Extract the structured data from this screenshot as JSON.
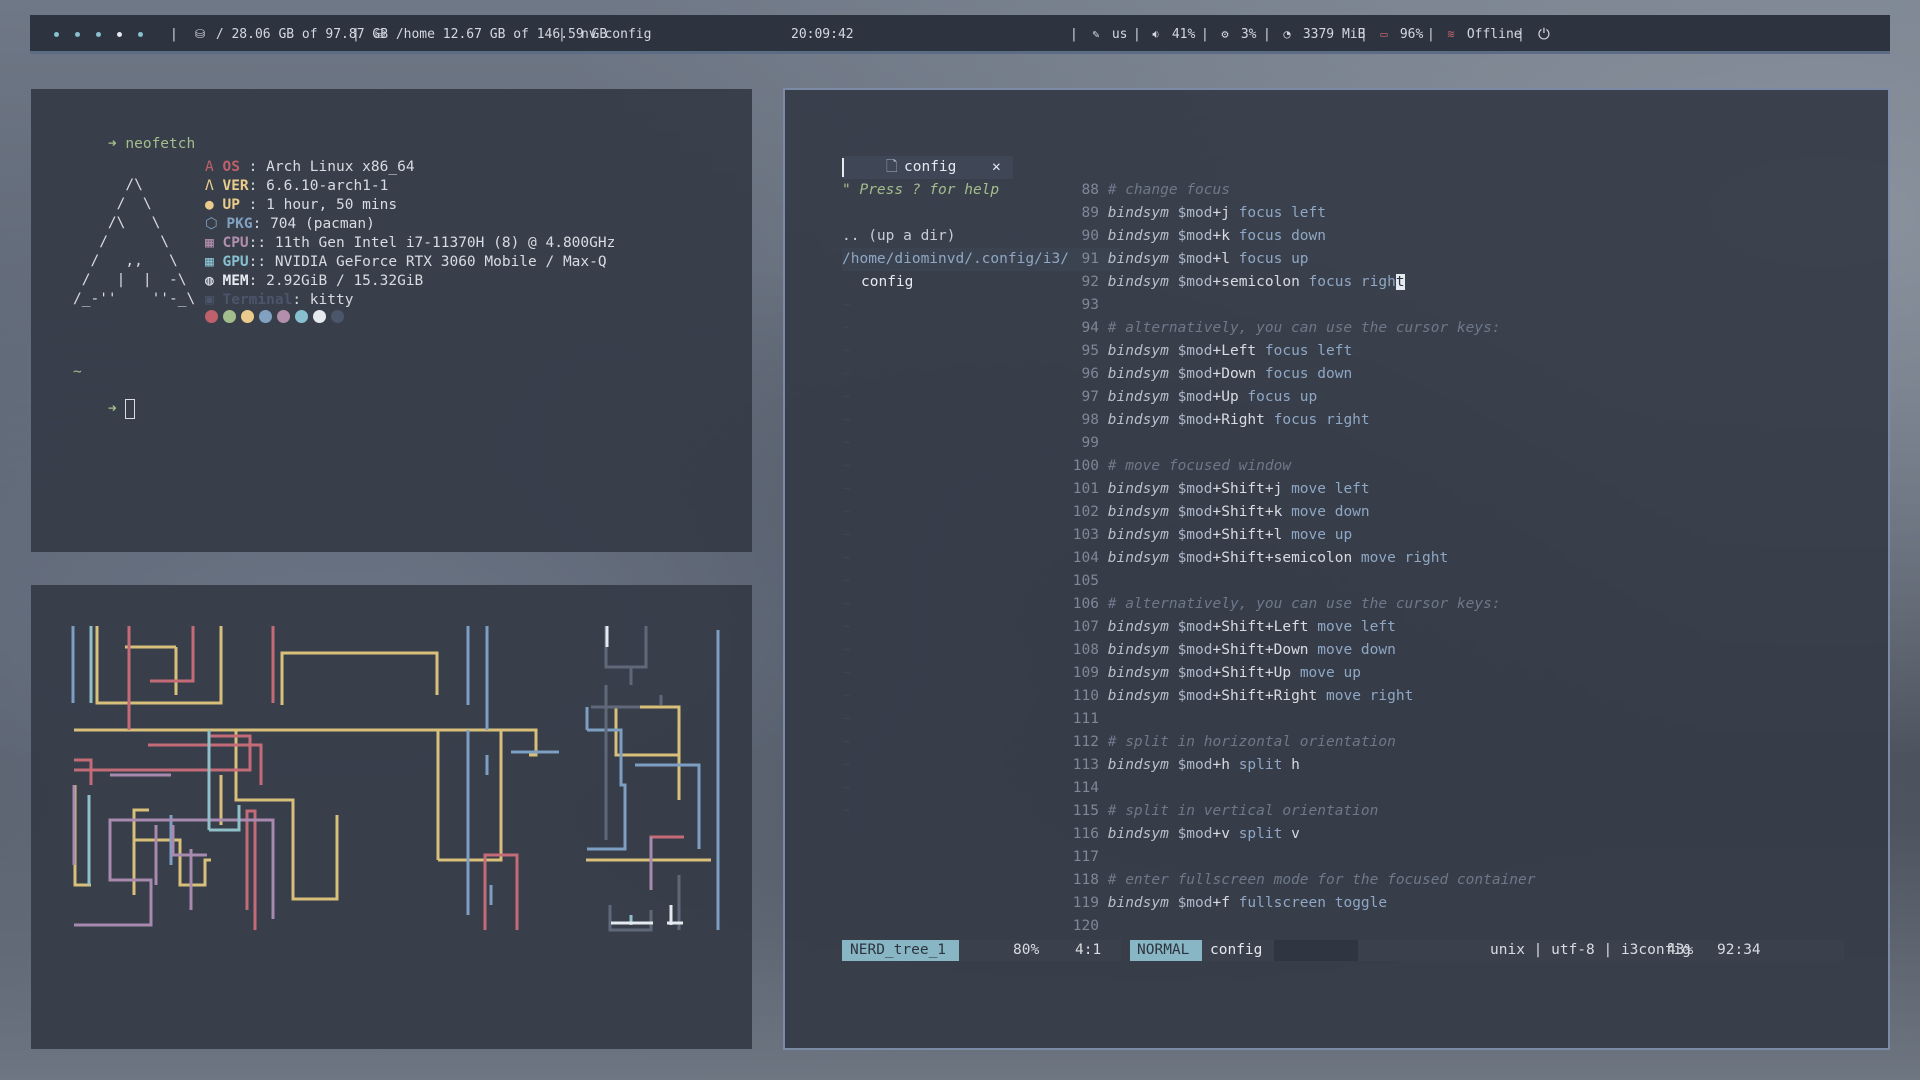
{
  "bar": {
    "workspaces": [
      "●",
      "●",
      "●",
      "●",
      "●"
    ],
    "sep": "|",
    "disk_root": "/ 28.06 GB of 97.87 GB",
    "disk_home": "/home 12.67 GB of 146.59 GB",
    "window_title": "nv config",
    "clock": "20:09:42",
    "keyboard": "us",
    "volume": "41%",
    "cpu": "3%",
    "memory": "3379 MiB",
    "battery": "96%",
    "network": "Offline",
    "colors": {
      "bg": "#2d3440",
      "accent": "#5b6c84"
    }
  },
  "neofetch": {
    "command": "neofetch",
    "prompt_arrow": "➜",
    "logo": [
      "      /\\",
      "     /  \\",
      "    /\\   \\",
      "   /      \\",
      "  /   ,,   \\",
      " /   |  |  -\\",
      "/_-''    ''-_\\"
    ],
    "info": [
      {
        "icon": "A",
        "label": "OS",
        "sep": " : ",
        "value": "Arch Linux x86_64",
        "color": "c-red"
      },
      {
        "icon": "Λ",
        "label": "VER",
        "sep": ": ",
        "value": "6.6.10-arch1-1",
        "color": "c-yel"
      },
      {
        "icon": "●",
        "label": "UP",
        "sep": " : ",
        "value": "1 hour, 50 mins",
        "color": "c-yel"
      },
      {
        "icon": "⬡",
        "label": "PKG",
        "sep": ": ",
        "value": "704 (pacman)",
        "color": "c-blu"
      },
      {
        "icon": "▦",
        "label": "CPU",
        "sep": ":: ",
        "value": "11th Gen Intel i7-11370H (8) @ 4.800GHz",
        "color": "c-mag"
      },
      {
        "icon": "▦",
        "label": "GPU",
        "sep": ":: ",
        "value": "NVIDIA GeForce RTX 3060 Mobile / Max-Q",
        "color": "c-cyn"
      },
      {
        "icon": "◍",
        "label": "MEM",
        "sep": ": ",
        "value": "2.92GiB / 15.32GiB",
        "color": "c-wht"
      },
      {
        "icon": "▣",
        "label": "Terminal",
        "sep": ": ",
        "value": "kitty",
        "color": "c-dim"
      }
    ],
    "palette": [
      "#bf616a",
      "#a3be8c",
      "#ebcb8b",
      "#81a1c1",
      "#b48ead",
      "#88c0d0",
      "#e5e9f0",
      "#4c566a"
    ],
    "tilde": "~"
  },
  "nvim": {
    "tab_label": "config",
    "tab_close": "✕",
    "tree": {
      "help": "\" Press ? for help",
      "up": ".. (up a dir)",
      "path": "/home/diominvd/.config/i3/",
      "file": "config"
    },
    "lines": [
      {
        "n": "88",
        "tokens": [
          [
            "cmt",
            "# change focus"
          ]
        ]
      },
      {
        "n": "89",
        "tokens": [
          [
            "kw",
            "bindsym"
          ],
          [
            "nm",
            " "
          ],
          [
            "var",
            "$mod"
          ],
          [
            "nm",
            "+j "
          ],
          [
            "fn",
            "focus left"
          ]
        ]
      },
      {
        "n": "90",
        "tokens": [
          [
            "kw",
            "bindsym"
          ],
          [
            "nm",
            " "
          ],
          [
            "var",
            "$mod"
          ],
          [
            "nm",
            "+k "
          ],
          [
            "fn",
            "focus down"
          ]
        ]
      },
      {
        "n": "91",
        "tokens": [
          [
            "kw",
            "bindsym"
          ],
          [
            "nm",
            " "
          ],
          [
            "var",
            "$mod"
          ],
          [
            "nm",
            "+l "
          ],
          [
            "fn",
            "focus up"
          ]
        ]
      },
      {
        "n": "92",
        "tokens": [
          [
            "kw",
            "bindsym"
          ],
          [
            "nm",
            " "
          ],
          [
            "var",
            "$mod"
          ],
          [
            "nm",
            "+semicolon "
          ],
          [
            "fn",
            "focus righ"
          ],
          [
            "cur",
            "t"
          ]
        ]
      },
      {
        "n": "93",
        "tokens": []
      },
      {
        "n": "94",
        "tokens": [
          [
            "cmt",
            "# alternatively, you can use the cursor keys:"
          ]
        ]
      },
      {
        "n": "95",
        "tokens": [
          [
            "kw",
            "bindsym"
          ],
          [
            "nm",
            " "
          ],
          [
            "var",
            "$mod"
          ],
          [
            "nm",
            "+Left "
          ],
          [
            "fn",
            "focus left"
          ]
        ]
      },
      {
        "n": "96",
        "tokens": [
          [
            "kw",
            "bindsym"
          ],
          [
            "nm",
            " "
          ],
          [
            "var",
            "$mod"
          ],
          [
            "nm",
            "+Down "
          ],
          [
            "fn",
            "focus down"
          ]
        ]
      },
      {
        "n": "97",
        "tokens": [
          [
            "kw",
            "bindsym"
          ],
          [
            "nm",
            " "
          ],
          [
            "var",
            "$mod"
          ],
          [
            "nm",
            "+Up "
          ],
          [
            "fn",
            "focus up"
          ]
        ]
      },
      {
        "n": "98",
        "tokens": [
          [
            "kw",
            "bindsym"
          ],
          [
            "nm",
            " "
          ],
          [
            "var",
            "$mod"
          ],
          [
            "nm",
            "+Right "
          ],
          [
            "fn",
            "focus right"
          ]
        ]
      },
      {
        "n": "99",
        "tokens": []
      },
      {
        "n": "100",
        "tokens": [
          [
            "cmt",
            "# move focused window"
          ]
        ]
      },
      {
        "n": "101",
        "tokens": [
          [
            "kw",
            "bindsym"
          ],
          [
            "nm",
            " "
          ],
          [
            "var",
            "$mod"
          ],
          [
            "nm",
            "+Shift+j "
          ],
          [
            "fn",
            "move left"
          ]
        ]
      },
      {
        "n": "102",
        "tokens": [
          [
            "kw",
            "bindsym"
          ],
          [
            "nm",
            " "
          ],
          [
            "var",
            "$mod"
          ],
          [
            "nm",
            "+Shift+k "
          ],
          [
            "fn",
            "move down"
          ]
        ]
      },
      {
        "n": "103",
        "tokens": [
          [
            "kw",
            "bindsym"
          ],
          [
            "nm",
            " "
          ],
          [
            "var",
            "$mod"
          ],
          [
            "nm",
            "+Shift+l "
          ],
          [
            "fn",
            "move up"
          ]
        ]
      },
      {
        "n": "104",
        "tokens": [
          [
            "kw",
            "bindsym"
          ],
          [
            "nm",
            " "
          ],
          [
            "var",
            "$mod"
          ],
          [
            "nm",
            "+Shift+semicolon "
          ],
          [
            "fn",
            "move right"
          ]
        ]
      },
      {
        "n": "105",
        "tokens": []
      },
      {
        "n": "106",
        "tokens": [
          [
            "cmt",
            "# alternatively, you can use the cursor keys:"
          ]
        ]
      },
      {
        "n": "107",
        "tokens": [
          [
            "kw",
            "bindsym"
          ],
          [
            "nm",
            " "
          ],
          [
            "var",
            "$mod"
          ],
          [
            "nm",
            "+Shift+Left "
          ],
          [
            "fn",
            "move left"
          ]
        ]
      },
      {
        "n": "108",
        "tokens": [
          [
            "kw",
            "bindsym"
          ],
          [
            "nm",
            " "
          ],
          [
            "var",
            "$mod"
          ],
          [
            "nm",
            "+Shift+Down "
          ],
          [
            "fn",
            "move down"
          ]
        ]
      },
      {
        "n": "109",
        "tokens": [
          [
            "kw",
            "bindsym"
          ],
          [
            "nm",
            " "
          ],
          [
            "var",
            "$mod"
          ],
          [
            "nm",
            "+Shift+Up "
          ],
          [
            "fn",
            "move up"
          ]
        ]
      },
      {
        "n": "110",
        "tokens": [
          [
            "kw",
            "bindsym"
          ],
          [
            "nm",
            " "
          ],
          [
            "var",
            "$mod"
          ],
          [
            "nm",
            "+Shift+Right "
          ],
          [
            "fn",
            "move right"
          ]
        ]
      },
      {
        "n": "111",
        "tokens": []
      },
      {
        "n": "112",
        "tokens": [
          [
            "cmt",
            "# split in horizontal orientation"
          ]
        ]
      },
      {
        "n": "113",
        "tokens": [
          [
            "kw",
            "bindsym"
          ],
          [
            "nm",
            " "
          ],
          [
            "var",
            "$mod"
          ],
          [
            "nm",
            "+h "
          ],
          [
            "fn",
            "split "
          ],
          [
            "nm",
            "h"
          ]
        ]
      },
      {
        "n": "114",
        "tokens": []
      },
      {
        "n": "115",
        "tokens": [
          [
            "cmt",
            "# split in vertical orientation"
          ]
        ]
      },
      {
        "n": "116",
        "tokens": [
          [
            "kw",
            "bindsym"
          ],
          [
            "nm",
            " "
          ],
          [
            "var",
            "$mod"
          ],
          [
            "nm",
            "+v "
          ],
          [
            "fn",
            "split "
          ],
          [
            "nm",
            "v"
          ]
        ]
      },
      {
        "n": "117",
        "tokens": []
      },
      {
        "n": "118",
        "tokens": [
          [
            "cmt",
            "# enter fullscreen mode for the focused container"
          ]
        ]
      },
      {
        "n": "119",
        "tokens": [
          [
            "kw",
            "bindsym"
          ],
          [
            "nm",
            " "
          ],
          [
            "var",
            "$mod"
          ],
          [
            "nm",
            "+f "
          ],
          [
            "fn",
            "fullscreen toggle"
          ]
        ]
      },
      {
        "n": "120",
        "tokens": []
      }
    ],
    "status": {
      "tree_name": "NERD_tree_1",
      "tree_pct": "80%",
      "tree_pos": "4:1",
      "mode": "NORMAL",
      "file": "config",
      "fileinfo": "unix | utf-8 | i3config",
      "pct": "43%",
      "pos": "92:34"
    }
  }
}
